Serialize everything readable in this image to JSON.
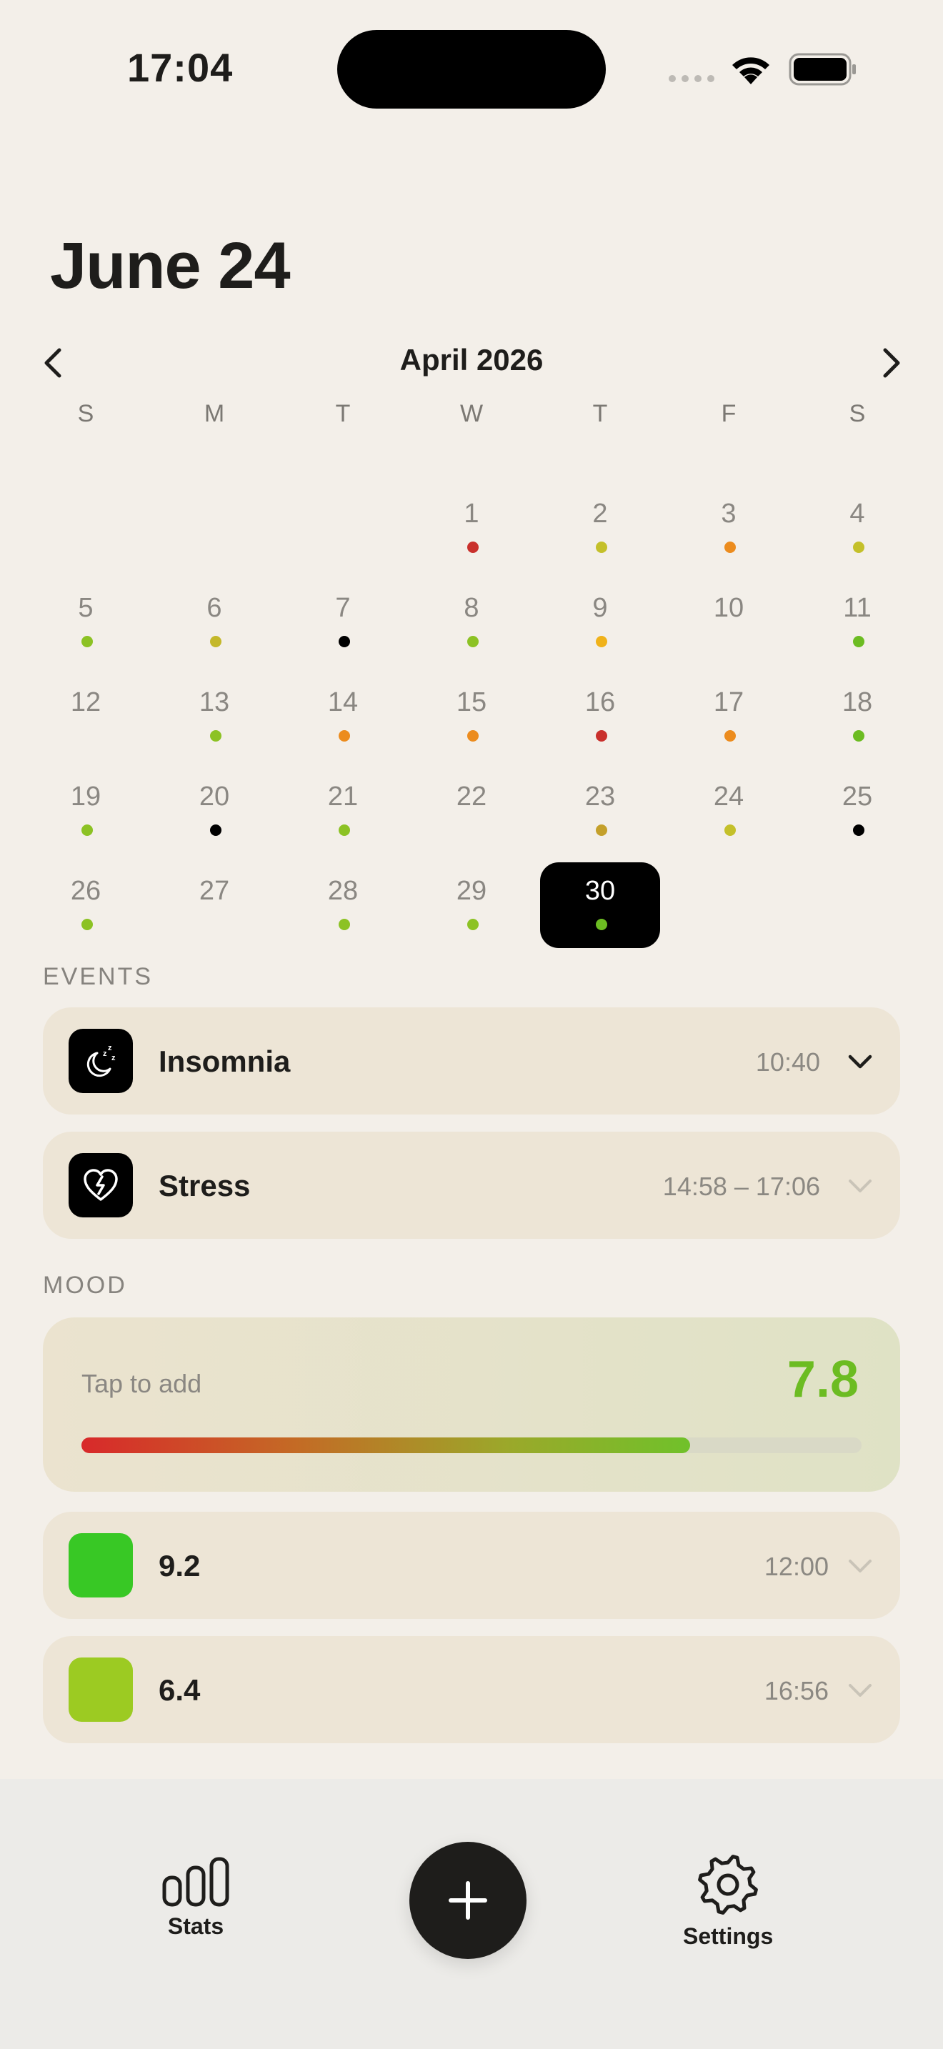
{
  "status_bar": {
    "time": "17:04"
  },
  "header": {
    "title": "June 24"
  },
  "calendar": {
    "month_label": "April 2026",
    "weekday_labels": [
      "S",
      "M",
      "T",
      "W",
      "T",
      "F",
      "S"
    ],
    "selected_day": "30",
    "weeks": [
      [
        {
          "day": ""
        },
        {
          "day": ""
        },
        {
          "day": ""
        },
        {
          "day": "1",
          "dot": "#c9302c"
        },
        {
          "day": "2",
          "dot": "#c4c02a"
        },
        {
          "day": "3",
          "dot": "#ec8c1e"
        },
        {
          "day": "4",
          "dot": "#c4c02a"
        }
      ],
      [
        {
          "day": "5",
          "dot": "#8cc224"
        },
        {
          "day": "6",
          "dot": "#c4b82a"
        },
        {
          "day": "7",
          "dot": "#000000"
        },
        {
          "day": "8",
          "dot": "#8cc224"
        },
        {
          "day": "9",
          "dot": "#f0b21a"
        },
        {
          "day": "10"
        },
        {
          "day": "11",
          "dot": "#6cbc22"
        }
      ],
      [
        {
          "day": "12"
        },
        {
          "day": "13",
          "dot": "#8cc224"
        },
        {
          "day": "14",
          "dot": "#ec8c1e"
        },
        {
          "day": "15",
          "dot": "#ec8c1e"
        },
        {
          "day": "16",
          "dot": "#c9302c"
        },
        {
          "day": "17",
          "dot": "#ec8c1e"
        },
        {
          "day": "18",
          "dot": "#6cbc22"
        }
      ],
      [
        {
          "day": "19",
          "dot": "#8cc224"
        },
        {
          "day": "20",
          "dot": "#000000"
        },
        {
          "day": "21",
          "dot": "#8cc224"
        },
        {
          "day": "22"
        },
        {
          "day": "23",
          "dot": "#c4a02a"
        },
        {
          "day": "24",
          "dot": "#c4c02a"
        },
        {
          "day": "25",
          "dot": "#000000"
        }
      ],
      [
        {
          "day": "26",
          "dot": "#8cc224"
        },
        {
          "day": "27"
        },
        {
          "day": "28",
          "dot": "#8cc224"
        },
        {
          "day": "29",
          "dot": "#8cc224"
        },
        {
          "day": "30",
          "dot": "#6cbc22",
          "selected": true
        },
        {
          "day": ""
        },
        {
          "day": ""
        }
      ]
    ]
  },
  "events": {
    "section_label": "EVENTS",
    "items": [
      {
        "title": "Insomnia",
        "time": "10:40",
        "icon": "moon-zzz-icon"
      },
      {
        "title": "Stress",
        "time": "14:58 – 17:06",
        "icon": "broken-heart-icon"
      }
    ]
  },
  "mood": {
    "section_label": "MOOD",
    "hint": "Tap to add",
    "average": "7.8",
    "average_fraction": 0.78,
    "entries": [
      {
        "value": "9.2",
        "time": "12:00",
        "color": "#38c825"
      },
      {
        "value": "6.4",
        "time": "16:56",
        "color": "#9ccb22"
      }
    ]
  },
  "tab_bar": {
    "stats_label": "Stats",
    "settings_label": "Settings"
  }
}
